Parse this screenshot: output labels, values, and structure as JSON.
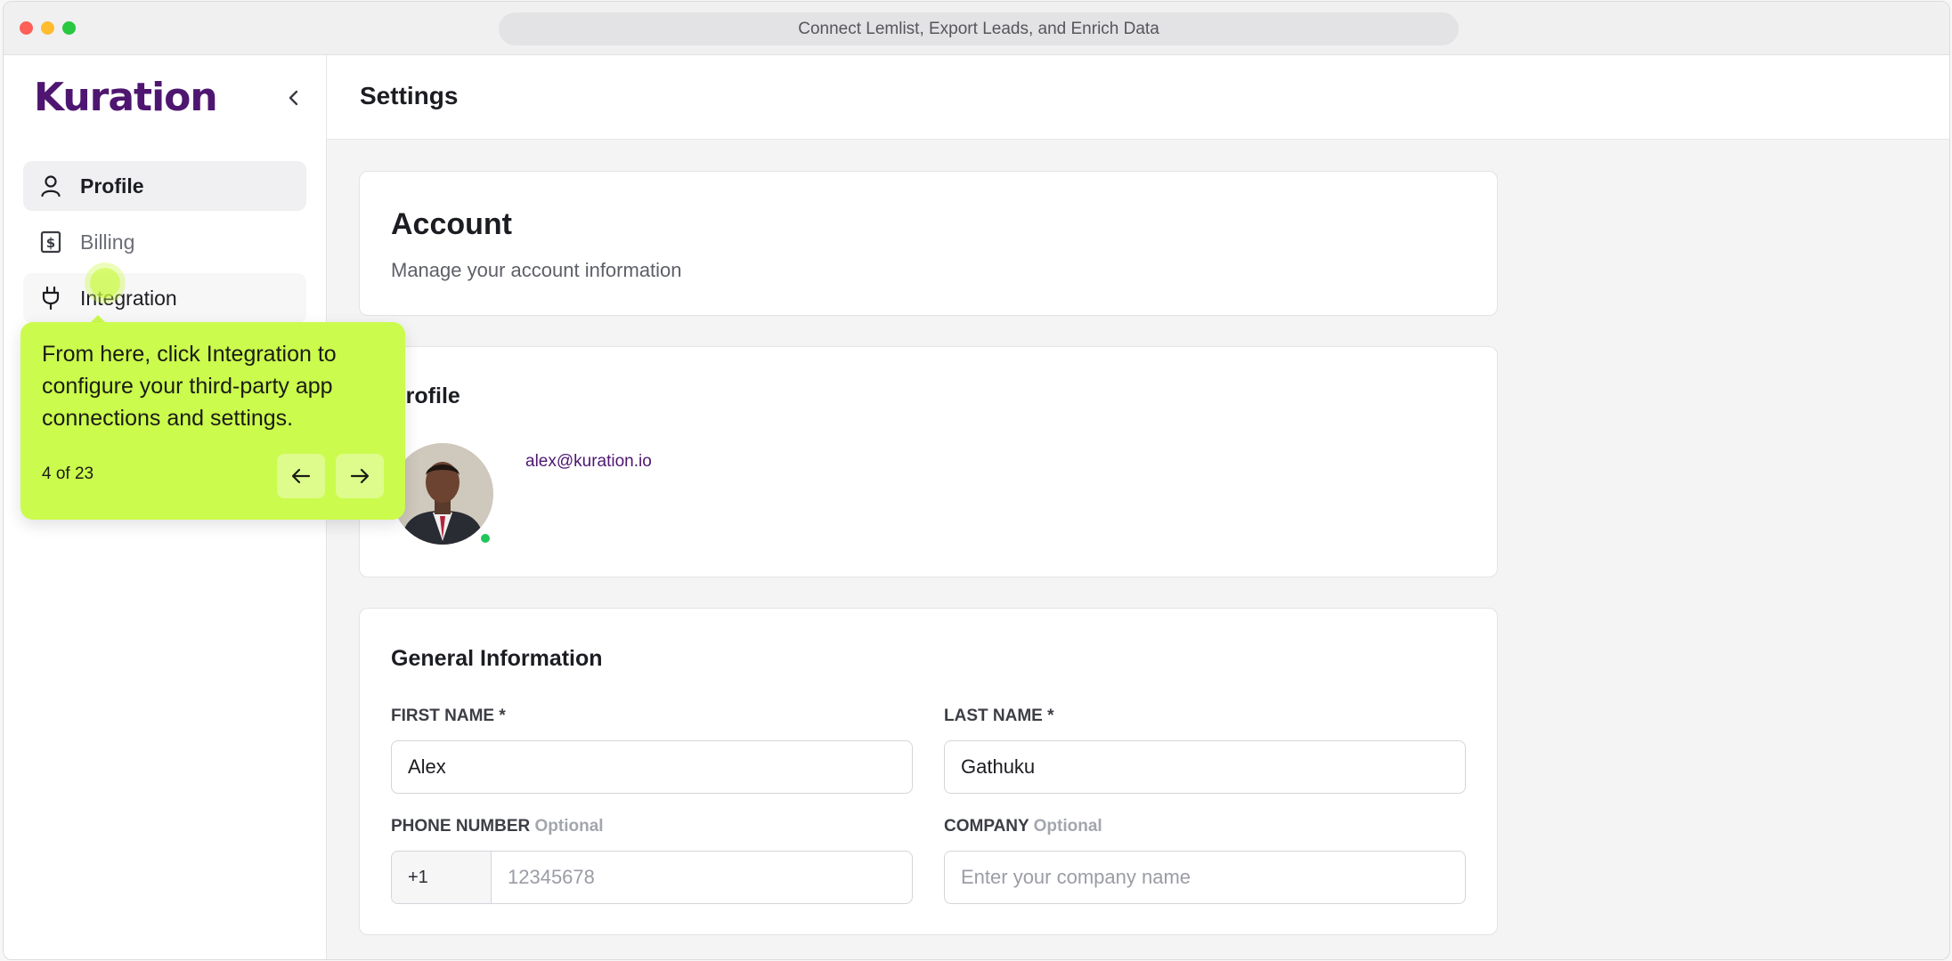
{
  "window": {
    "title": "Connect Lemlist, Export Leads, and Enrich Data"
  },
  "sidebar": {
    "logo": "Kuration",
    "items": [
      {
        "label": "Profile",
        "icon": "user-icon"
      },
      {
        "label": "Billing",
        "icon": "dollar-square-icon"
      },
      {
        "label": "Integration",
        "icon": "plug-icon"
      }
    ]
  },
  "header": {
    "title": "Settings"
  },
  "account": {
    "title": "Account",
    "subtitle": "Manage your account information"
  },
  "profile": {
    "title": "Profile",
    "email": "alex@kuration.io"
  },
  "general": {
    "title": "General Information",
    "first_name": {
      "label": "FIRST NAME *",
      "value": "Alex"
    },
    "last_name": {
      "label": "LAST NAME *",
      "value": "Gathuku"
    },
    "phone": {
      "label": "PHONE NUMBER",
      "optional": "Optional",
      "code": "+1",
      "placeholder": "12345678"
    },
    "company": {
      "label": "COMPANY",
      "optional": "Optional",
      "placeholder": "Enter your company name"
    }
  },
  "tooltip": {
    "text": "From here, click Integration to configure your third-party app connections and settings.",
    "step": "4 of 23",
    "accent": "#cbfb4d"
  }
}
